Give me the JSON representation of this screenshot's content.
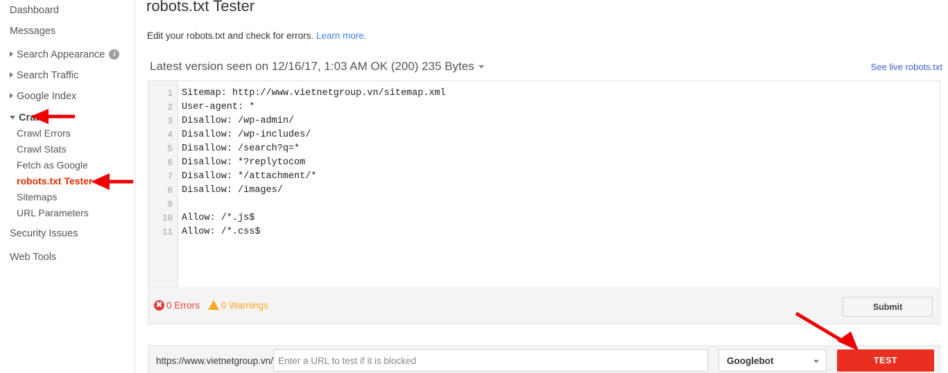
{
  "sidebar": {
    "items": [
      {
        "label": "Dashboard",
        "type": "top",
        "icon": "none"
      },
      {
        "label": "Messages",
        "type": "top",
        "icon": "none"
      },
      {
        "label": "Search Appearance",
        "type": "expandable",
        "icon": "chevron-right-icon",
        "info": true
      },
      {
        "label": "Search Traffic",
        "type": "expandable",
        "icon": "chevron-right-icon"
      },
      {
        "label": "Google Index",
        "type": "expandable",
        "icon": "chevron-right-icon"
      },
      {
        "label": "Crawl",
        "type": "expanded",
        "icon": "chevron-down-icon"
      },
      {
        "label": "Crawl Errors",
        "type": "sub"
      },
      {
        "label": "Crawl Stats",
        "type": "sub"
      },
      {
        "label": "Fetch as Google",
        "type": "sub"
      },
      {
        "label": "robots.txt Tester",
        "type": "sub",
        "active": true
      },
      {
        "label": "Sitemaps",
        "type": "sub"
      },
      {
        "label": "URL Parameters",
        "type": "sub"
      },
      {
        "label": "Security Issues",
        "type": "top"
      },
      {
        "label": "Web Tools",
        "type": "top"
      }
    ]
  },
  "header": {
    "title": "robots.txt Tester",
    "subtitle_text": "Edit your robots.txt and check for errors.",
    "learn_more_label": "Learn more.",
    "version_line": "Latest version seen on 12/16/17, 1:03 AM OK (200) 235 Bytes",
    "see_live_label": "See live robots.txt"
  },
  "editor": {
    "lines": [
      {
        "n": "1",
        "text": "Sitemap: http://www.vietnetgroup.vn/sitemap.xml"
      },
      {
        "n": "2",
        "text": "User-agent: *"
      },
      {
        "n": "3",
        "text": "Disallow: /wp-admin/"
      },
      {
        "n": "4",
        "text": "Disallow: /wp-includes/"
      },
      {
        "n": "5",
        "text": "Disallow: /search?q=*"
      },
      {
        "n": "6",
        "text": "Disallow: *?replytocom"
      },
      {
        "n": "7",
        "text": "Disallow: */attachment/*"
      },
      {
        "n": "8",
        "text": "Disallow: /images/"
      },
      {
        "n": "9",
        "text": ""
      },
      {
        "n": "10",
        "text": "Allow: /*.js$"
      },
      {
        "n": "11",
        "text": "Allow: /*.css$"
      }
    ]
  },
  "status": {
    "errors_label": "0 Errors",
    "warnings_label": "0 Warnings",
    "error_icon_glyph": "✖",
    "submit_label": "Submit"
  },
  "test_bar": {
    "url_prefix": "https://www.vietnetgroup.vn/",
    "url_placeholder": "Enter a URL to test if it is blocked",
    "url_value": "",
    "bot_selected": "Googlebot",
    "test_label": "TEST"
  },
  "colors": {
    "accent_red": "#ea2e1f",
    "link_blue": "#3b5cdb",
    "learn_more_blue": "#4285f4",
    "active_nav_red": "#dd2c00",
    "error_red": "#e8453c",
    "warning_orange": "#f9a825",
    "annotation_red": "#ee0000"
  }
}
